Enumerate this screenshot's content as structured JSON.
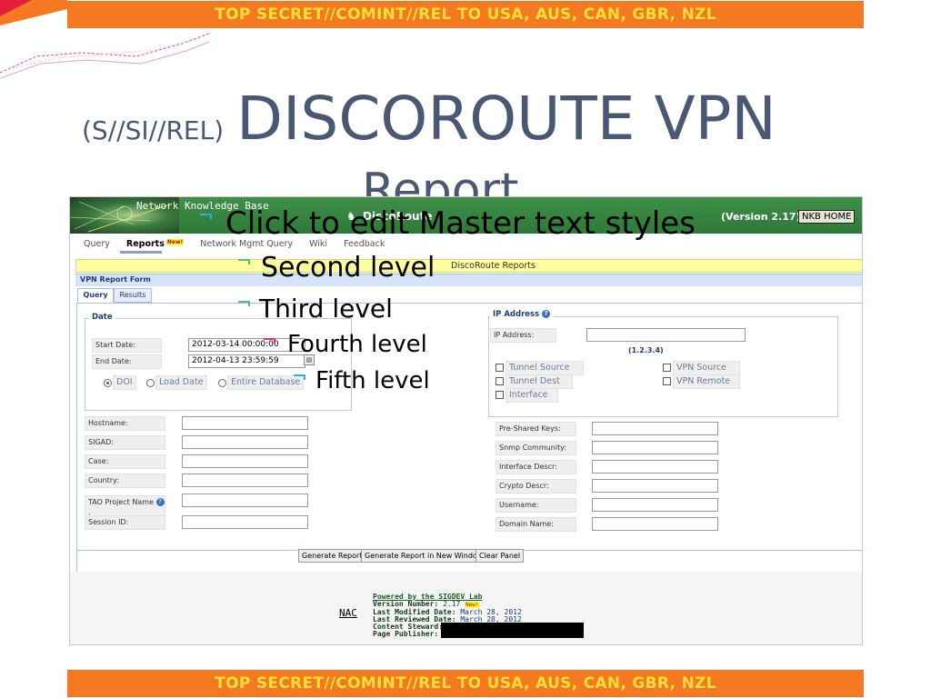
{
  "classification": "TOP SECRET//COMINT//REL TO USA, AUS, CAN, GBR, NZL",
  "title": {
    "prefix": "(S//SI//REL)",
    "main": "DISCOROUTE VPN",
    "line2": "Report"
  },
  "app": {
    "header_title": "Network Knowledge Base",
    "app_name": "DiscoRoute",
    "version": "(Version 2.17)",
    "home_button": "NKB HOME",
    "nav": [
      "Query",
      "Reports",
      "Network Mgmt Query",
      "Wiki",
      "Feedback"
    ],
    "nav_new_badge": "New!",
    "section_title": "DiscoRoute Reports",
    "form_title": "VPN Report Form",
    "tabs": [
      "Query",
      "Results"
    ],
    "date": {
      "legend": "Date",
      "start_label": "Start Date:",
      "start_value": "2012-03-14 00:00:00",
      "end_label": "End Date:",
      "end_value": "2012-04-13 23:59:59",
      "radio_options": [
        "DOI",
        "Load Date",
        "Entire Database"
      ],
      "radio_selected": "DOI"
    },
    "ip": {
      "legend": "IP Address",
      "label": "IP Address:",
      "value": "",
      "hint": "(1.2.3.4)",
      "checks_left": [
        "Tunnel Source",
        "Tunnel Dest",
        "Interface"
      ],
      "checks_right": [
        "VPN Source",
        "VPN Remote"
      ]
    },
    "left_fields": [
      "Hostname:",
      "SIGAD:",
      "Case:",
      "Country:",
      "TAO Project Name",
      "Session ID:"
    ],
    "left_field_values": [
      "",
      "",
      "",
      "",
      "",
      ""
    ],
    "right_fields": [
      "Pre-Shared Keys:",
      "Snmp Community:",
      "Interface Descr:",
      "Crypto Descr:",
      "Username:",
      "Domain Name:"
    ],
    "right_field_values": [
      "",
      "",
      "",
      "",
      "",
      ""
    ],
    "buttons": [
      "Generate Report",
      "Generate Report in New Window",
      "Clear Panel"
    ],
    "footer": {
      "nac": "NAC",
      "powered": "Powered by the SIGDEV Lab",
      "version_label": "Version Number:",
      "version_value": "2.17",
      "modified_label": "Last Modified Date:",
      "modified_value": "March 28, 2012",
      "reviewed_label": "Last Reviewed Date:",
      "reviewed_value": "March 28, 2012",
      "steward_label": "Content Steward:",
      "publisher_label": "Page Publisher:"
    }
  },
  "master_styles": [
    "Click to edit Master text styles",
    "Second level",
    "Third level",
    "Fourth level",
    "Fifth level"
  ],
  "colors": {
    "banner_bg": "#f47920",
    "banner_text": "#f7e13a",
    "title": "#4a5873",
    "header_green": "#3f8f49"
  }
}
